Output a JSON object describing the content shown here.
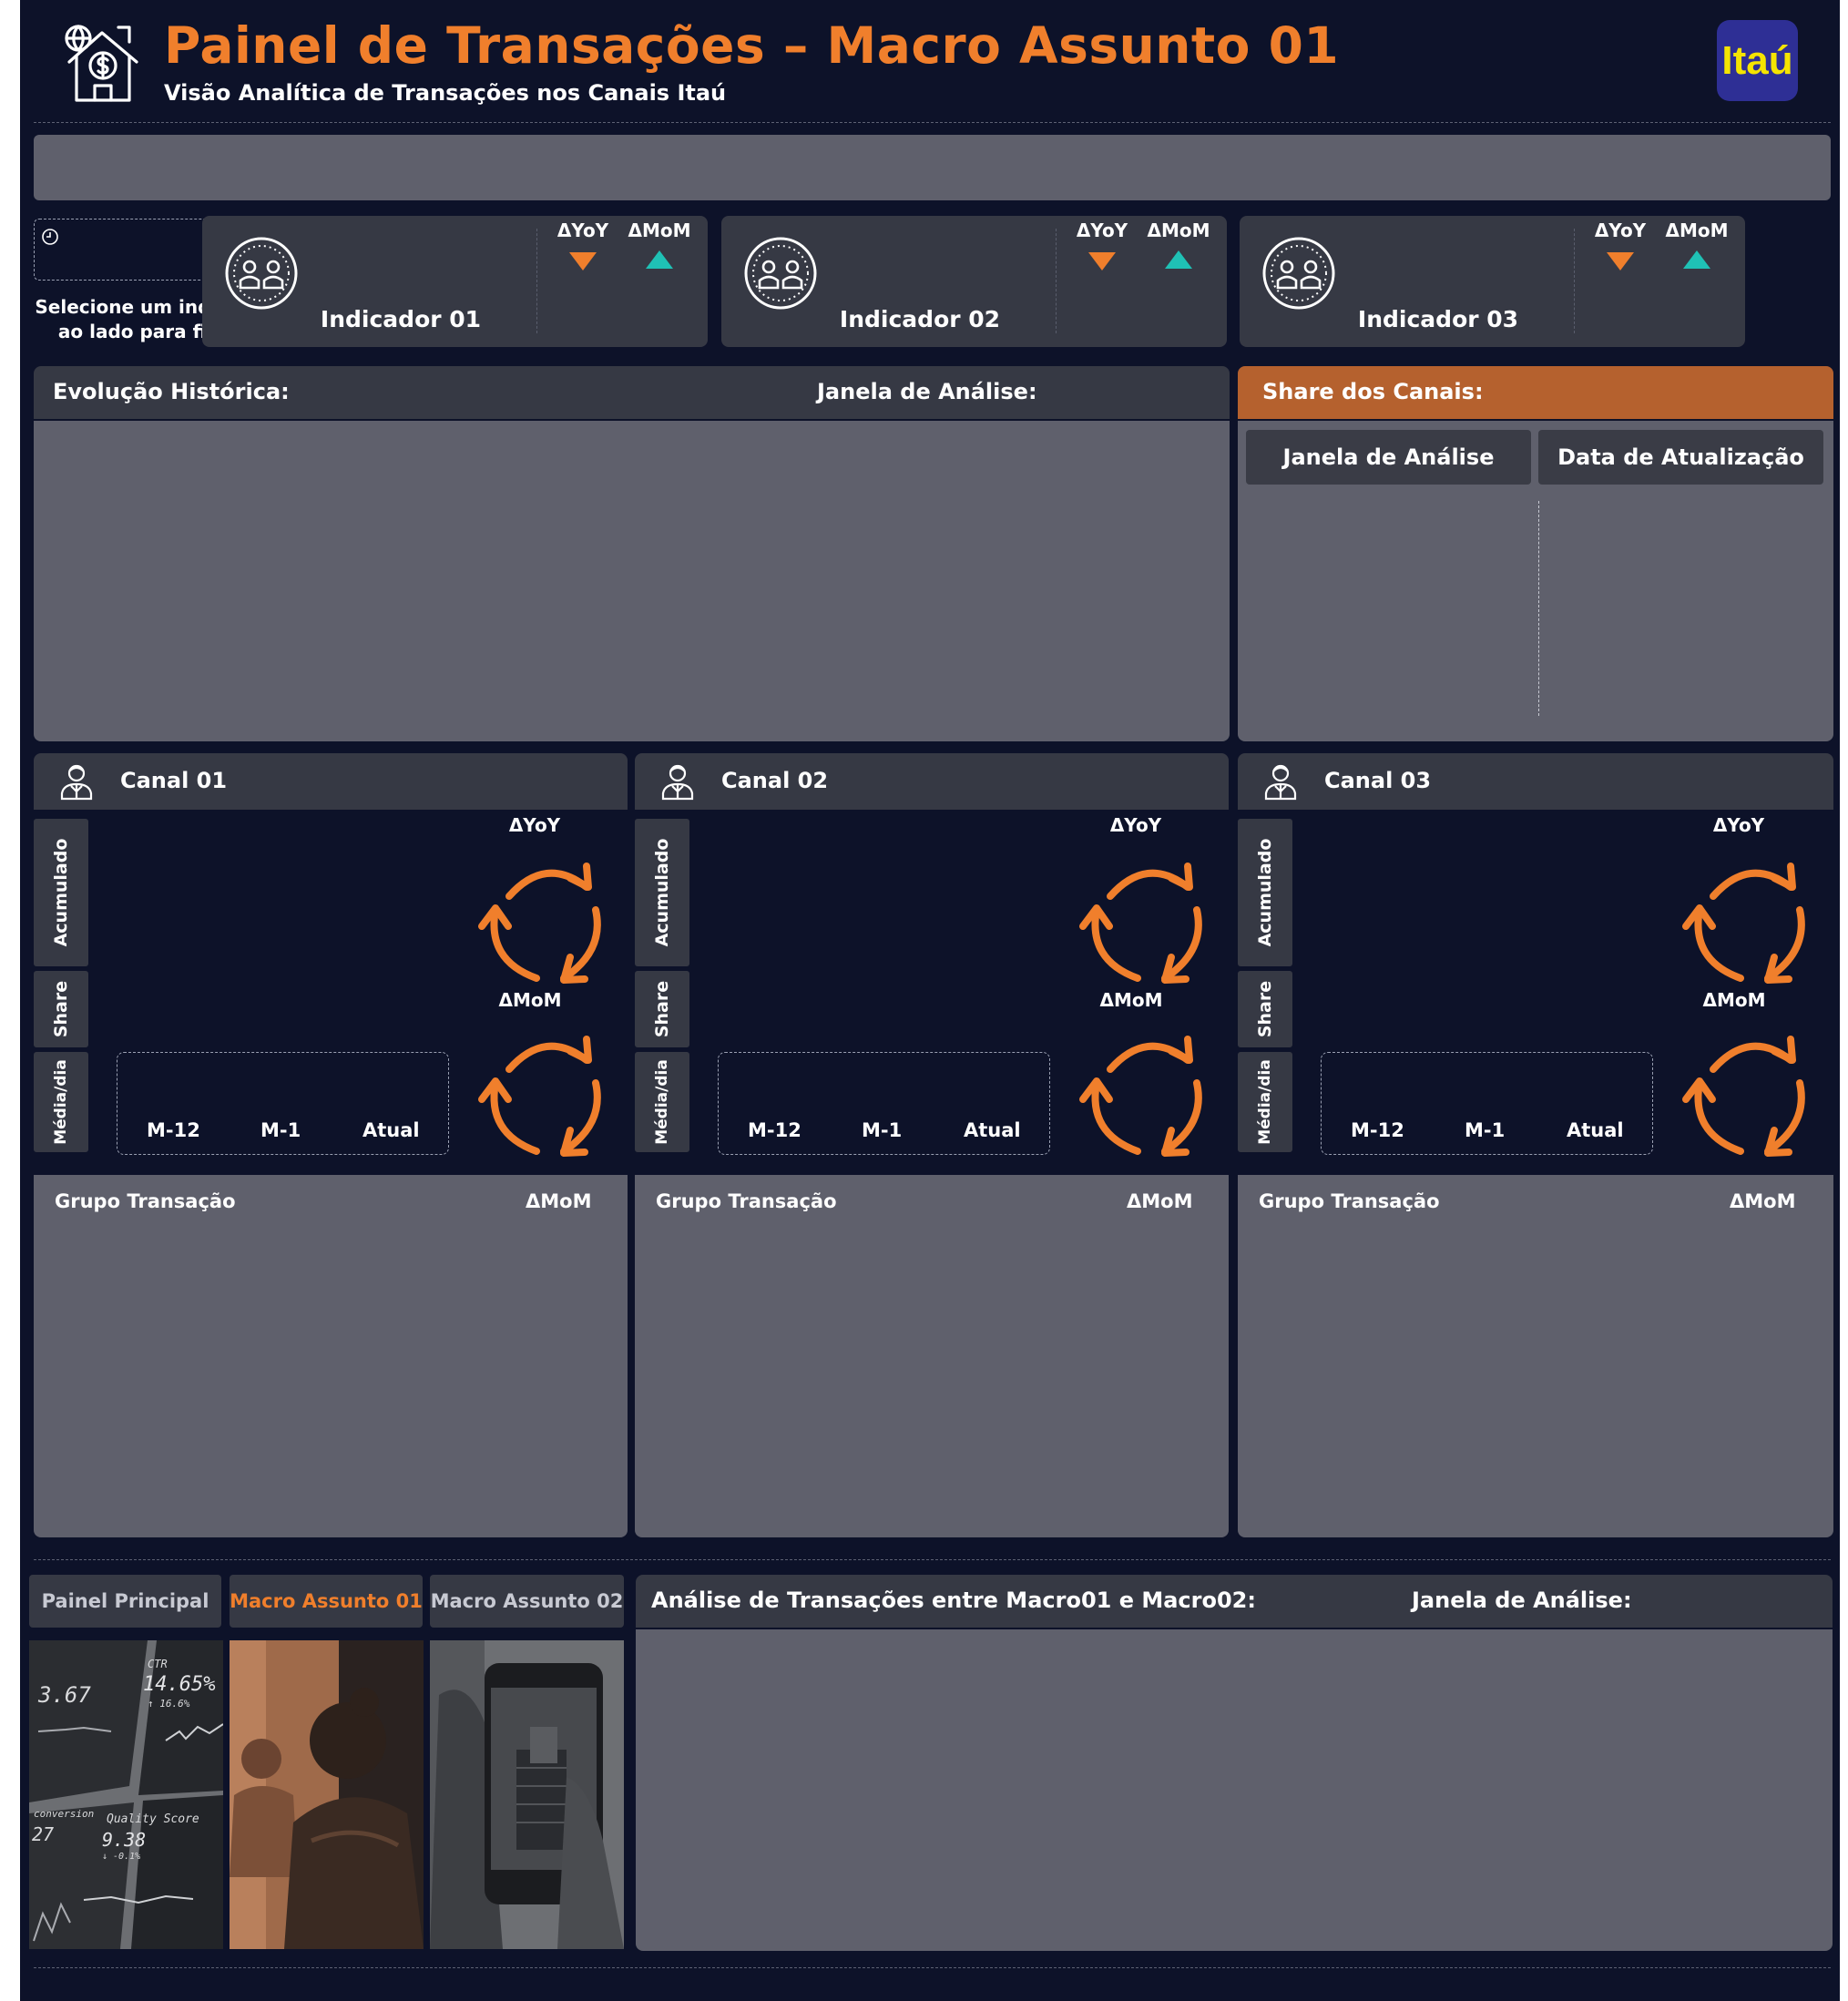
{
  "header": {
    "title": "Painel de Transações – Macro Assunto 01",
    "subtitle": "Visão Analítica de Transações nos Canais Itaú",
    "logo_text": "Itaú",
    "home_icon": "house-dollar-globe-icon",
    "accent_color": "#f07f2c",
    "background_color": "#0d1229"
  },
  "filters": {
    "selector_hint": "Selecione um indicador ao lado para filtrar",
    "clock_icon": "clock-icon"
  },
  "indicators": [
    {
      "name": "Indicador 01",
      "yoy_label": "ΔYoY",
      "mom_label": "ΔMoM",
      "yoy_trend": "down",
      "mom_trend": "up"
    },
    {
      "name": "Indicador 02",
      "yoy_label": "ΔYoY",
      "mom_label": "ΔMoM",
      "yoy_trend": "down",
      "mom_trend": "up"
    },
    {
      "name": "Indicador 03",
      "yoy_label": "ΔYoY",
      "mom_label": "ΔMoM",
      "yoy_trend": "down",
      "mom_trend": "up"
    }
  ],
  "trend_colors": {
    "down": "#f07f2c",
    "up": "#1fc1b5"
  },
  "history": {
    "title": "Evolução Histórica:",
    "window_label": "Janela de Análise:"
  },
  "share": {
    "title": "Share dos Canais:",
    "window_button": "Janela de Análise",
    "update_button": "Data de Atualização",
    "title_color": "#b5612e"
  },
  "channels": [
    {
      "name": "Canal 01",
      "yoy_label": "ΔYoY",
      "mom_label": "ΔMoM",
      "tab_acumulado": "Acumulado",
      "tab_share": "Share",
      "tab_media": "Média/dia",
      "periods": [
        "M-12",
        "M-1",
        "Atual"
      ],
      "group_label": "Grupo Transação",
      "group_mom": "ΔMoM"
    },
    {
      "name": "Canal 02",
      "yoy_label": "ΔYoY",
      "mom_label": "ΔMoM",
      "tab_acumulado": "Acumulado",
      "tab_share": "Share",
      "tab_media": "Média/dia",
      "periods": [
        "M-12",
        "M-1",
        "Atual"
      ],
      "group_label": "Grupo Transação",
      "group_mom": "ΔMoM"
    },
    {
      "name": "Canal 03",
      "yoy_label": "ΔYoY",
      "mom_label": "ΔMoM",
      "tab_acumulado": "Acumulado",
      "tab_share": "Share",
      "tab_media": "Média/dia",
      "periods": [
        "M-12",
        "M-1",
        "Atual"
      ],
      "group_label": "Grupo Transação",
      "group_mom": "ΔMoM"
    }
  ],
  "navigation": {
    "tabs": [
      {
        "label": "Painel Principal",
        "active": false
      },
      {
        "label": "Macro Assunto 01",
        "active": true
      },
      {
        "label": "Macro Assunto 02",
        "active": false
      }
    ],
    "photo_texts": {
      "ctr": "CTR",
      "ctr_value": "14.65%",
      "ctr_delta": "↑ 16.6%",
      "value_left": "3.67",
      "conversion": "conversion",
      "conversion_value": "27",
      "quality": "Quality Score",
      "quality_value": "9.38",
      "quality_delta": "↓ -0.1%"
    }
  },
  "analysis": {
    "title": "Análise de Transações entre Macro01 e Macro02:",
    "window_label": "Janela de Análise:"
  }
}
